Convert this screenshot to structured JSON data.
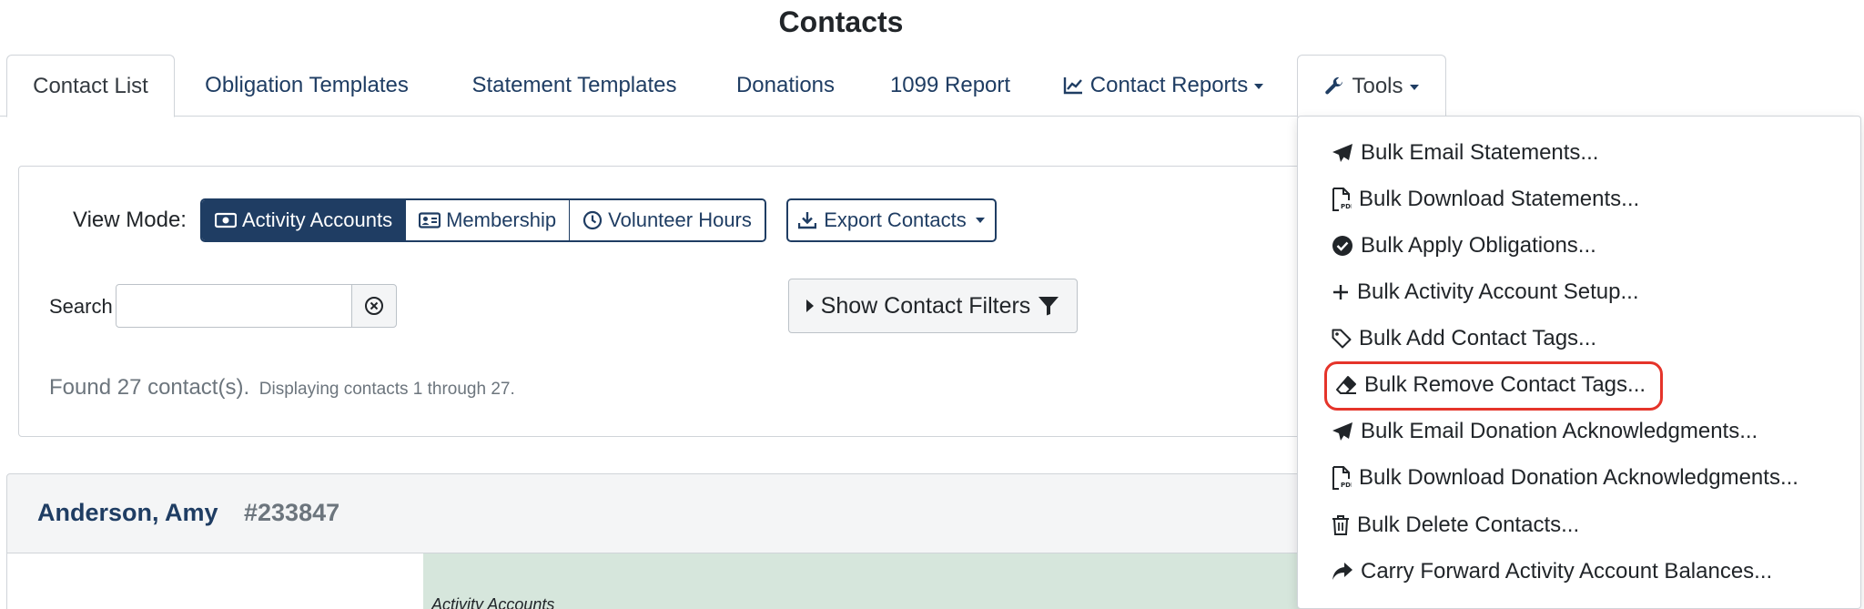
{
  "page_title": "Contacts",
  "tabs": [
    {
      "label": "Contact List",
      "active": true
    },
    {
      "label": "Obligation Templates"
    },
    {
      "label": "Statement Templates"
    },
    {
      "label": "Donations"
    },
    {
      "label": "1099 Report"
    },
    {
      "label": "Contact Reports",
      "icon": "line-chart-icon",
      "dropdown": true
    },
    {
      "label": "Tools",
      "icon": "wrench-icon",
      "dropdown": true,
      "open": true
    }
  ],
  "view_mode": {
    "label": "View Mode:",
    "options": [
      {
        "label": "Activity Accounts",
        "icon": "money-bill-icon",
        "selected": true
      },
      {
        "label": "Membership",
        "icon": "id-card-icon"
      },
      {
        "label": "Volunteer Hours",
        "icon": "clock-icon"
      }
    ]
  },
  "export": {
    "label": "Export Contacts",
    "icon": "download-icon"
  },
  "search": {
    "label": "Search",
    "value": "",
    "placeholder": ""
  },
  "filters_button": {
    "label": "Show Contact Filters",
    "icon": "filter-icon"
  },
  "found": {
    "main": "Found 27 contact(s).",
    "detail": "Displaying contacts 1 through 27."
  },
  "contact": {
    "name": "Anderson, Amy",
    "id": "#233847",
    "section_label": "Activity Accounts"
  },
  "tools_menu": {
    "items": [
      {
        "label": "Bulk Email Statements...",
        "icon": "paper-plane-icon"
      },
      {
        "label": "Bulk Download Statements...",
        "icon": "pdf-file-icon"
      },
      {
        "label": "Bulk Apply Obligations...",
        "icon": "check-circle-icon"
      },
      {
        "label": "Bulk Activity Account Setup...",
        "icon": "plus-icon"
      },
      {
        "label": "Bulk Add Contact Tags...",
        "icon": "tag-icon"
      },
      {
        "label": "Bulk Remove Contact Tags...",
        "icon": "eraser-icon",
        "highlighted": true
      },
      {
        "label": "Bulk Email Donation Acknowledgments...",
        "icon": "paper-plane-icon"
      },
      {
        "label": "Bulk Download Donation Acknowledgments...",
        "icon": "pdf-file-icon"
      },
      {
        "label": "Bulk Delete Contacts...",
        "icon": "trash-icon"
      },
      {
        "label": "Carry Forward Activity Account Balances...",
        "icon": "share-arrow-icon"
      }
    ]
  },
  "colors": {
    "primary": "#1f3d63",
    "highlight": "#e5342a",
    "green_panel": "#d6e6dc"
  }
}
